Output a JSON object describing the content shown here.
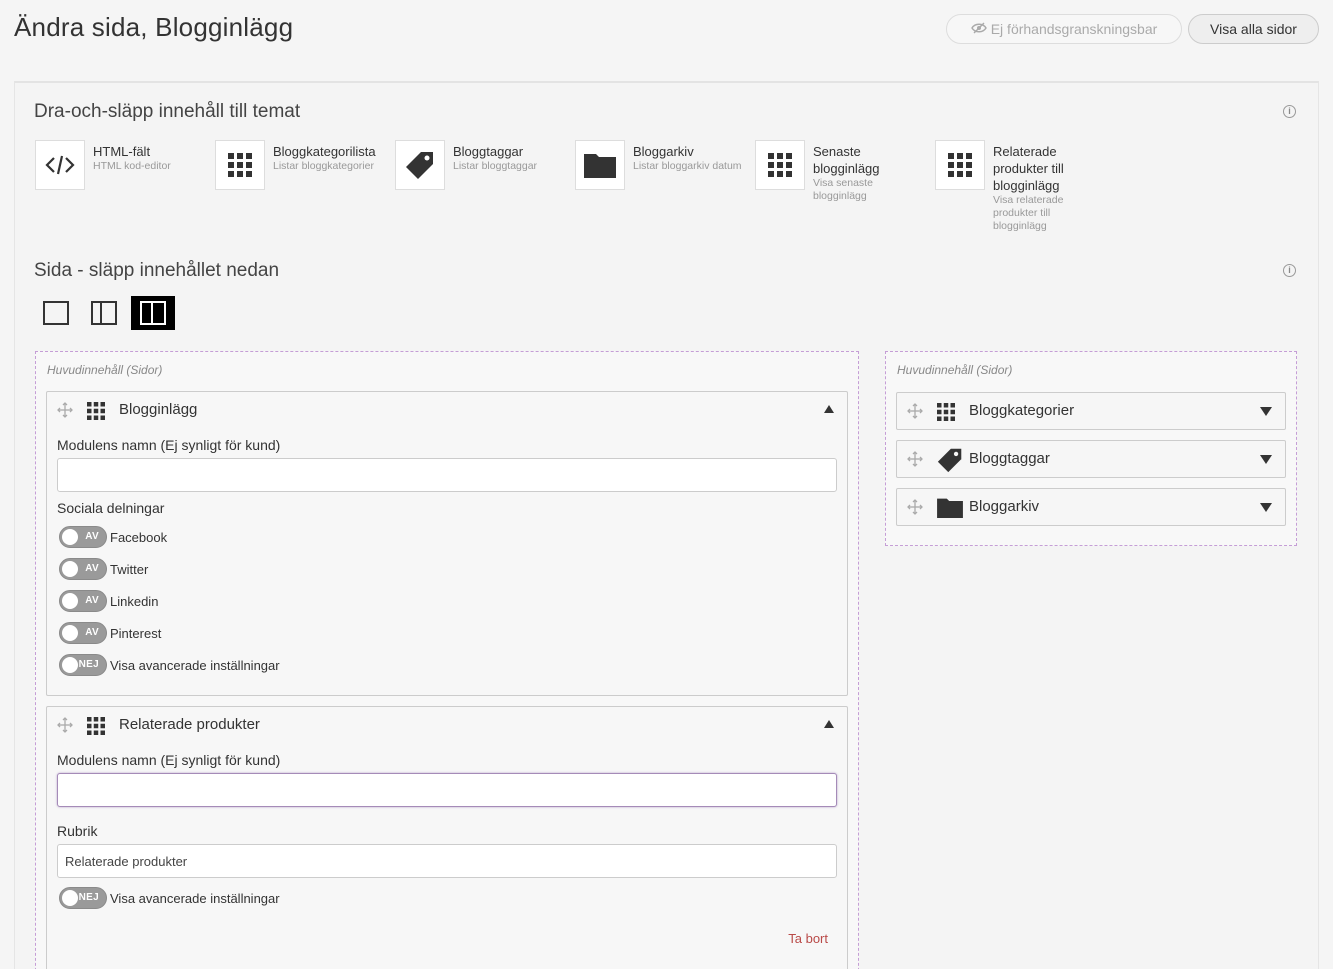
{
  "header": {
    "title": "Ändra sida, Blogginlägg",
    "preview_label": "Ej förhandsgranskningsbar",
    "view_all_label": "Visa alla sidor"
  },
  "palette": {
    "title": "Dra-och-släpp innehåll till temat",
    "items": [
      {
        "name": "HTML-fält",
        "desc": "HTML kod-editor",
        "icon": "code-icon"
      },
      {
        "name": "Bloggkategorilista",
        "desc": "Listar bloggkategorier",
        "icon": "grid-icon"
      },
      {
        "name": "Bloggtaggar",
        "desc": "Listar bloggtaggar",
        "icon": "tag-icon"
      },
      {
        "name": "Bloggarkiv",
        "desc": "Listar bloggarkiv datum",
        "icon": "folder-icon"
      },
      {
        "name": "Senaste blogginlägg",
        "desc": "Visa senaste blogginlägg",
        "icon": "grid-icon"
      },
      {
        "name": "Relaterade produkter till blogginlägg",
        "desc": "Visa relaterade produkter till blogginlägg",
        "icon": "grid-icon"
      }
    ]
  },
  "page_section": {
    "title": "Sida - släpp innehållet nedan"
  },
  "main_zone": {
    "label": "Huvudinnehåll (Sidor)",
    "modules": [
      {
        "title": "Blogginlägg",
        "name_label": "Modulens namn (Ej synligt för kund)",
        "name_value": "",
        "social_label": "Sociala delningar",
        "toggles": [
          {
            "state": "AV",
            "label": "Facebook"
          },
          {
            "state": "AV",
            "label": "Twitter"
          },
          {
            "state": "AV",
            "label": "Linkedin"
          },
          {
            "state": "AV",
            "label": "Pinterest"
          },
          {
            "state": "NEJ",
            "label": "Visa avancerade inställningar"
          }
        ]
      },
      {
        "title": "Relaterade produkter",
        "name_label": "Modulens namn (Ej synligt för kund)",
        "name_value": "",
        "rubrik_label": "Rubrik",
        "rubrik_value": "Relaterade produkter",
        "toggles": [
          {
            "state": "NEJ",
            "label": "Visa avancerade inställningar"
          }
        ],
        "delete_label": "Ta bort"
      }
    ]
  },
  "side_zone": {
    "label": "Huvudinnehåll (Sidor)",
    "modules": [
      {
        "title": "Bloggkategorier",
        "icon": "grid-icon"
      },
      {
        "title": "Bloggtaggar",
        "icon": "tag-icon"
      },
      {
        "title": "Bloggarkiv",
        "icon": "folder-icon"
      }
    ]
  }
}
